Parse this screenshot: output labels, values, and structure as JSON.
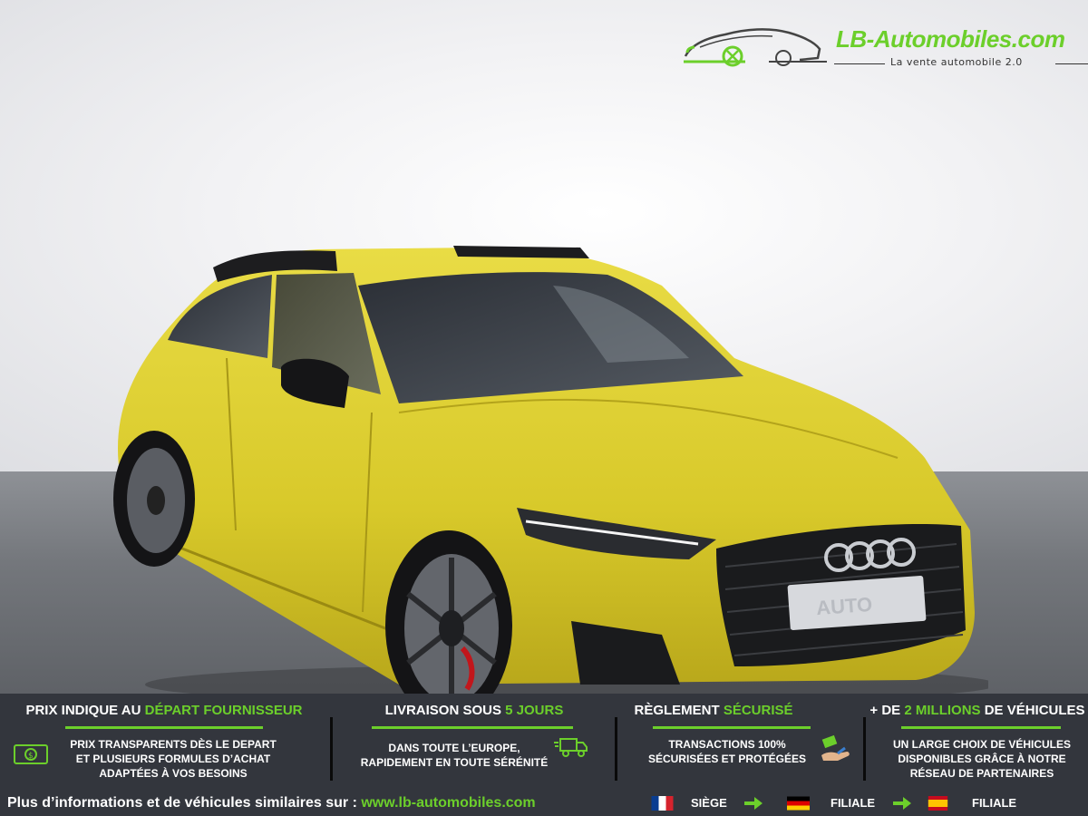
{
  "brand": {
    "name": "LB-Automobiles.com",
    "tagline": "La vente automobile 2.0",
    "color": "#6ccf2b"
  },
  "vehicle": {
    "body_color": "#d8c92a",
    "plate_text": "AUTO"
  },
  "features": [
    {
      "title_prefix": "PRIX INDIQUE AU ",
      "title_highlight": "DÉPART FOURNISSEUR",
      "title_suffix": "",
      "lines": [
        "PRIX TRANSPARENTS DÈS LE DEPART",
        "ET PLUSIEURS FORMULES D’ACHAT",
        "ADAPTÉES À VOS BESOINS"
      ],
      "icon": "money-icon"
    },
    {
      "title_prefix": "LIVRAISON SOUS ",
      "title_highlight": "5 JOURS",
      "title_suffix": "",
      "lines": [
        "DANS TOUTE L’EUROPE,",
        "RAPIDEMENT EN TOUTE SÉRÉNITÉ"
      ],
      "icon": "delivery-truck-icon"
    },
    {
      "title_prefix": "RÈGLEMENT ",
      "title_highlight": "SÉCURISÉ",
      "title_suffix": "",
      "lines": [
        "TRANSACTIONS 100%",
        "SÉCURISÉES ET PROTÉGÉES"
      ],
      "icon": "payment-hand-icon"
    },
    {
      "title_prefix": "+ DE ",
      "title_highlight": "2 MILLIONS",
      "title_suffix": " DE VÉHICULES",
      "lines": [
        "UN LARGE CHOIX DE VÉHICULES",
        "DISPONIBLES GRÂCE À NOTRE",
        "RÉSEAU DE PARTENAIRES"
      ],
      "icon": ""
    }
  ],
  "footer": {
    "text": "Plus d’informations et de véhicules similaires sur : ",
    "url": "www.lb-automobiles.com",
    "locations": [
      {
        "flag": "france-flag-icon",
        "label": "SIÈGE"
      },
      {
        "flag": "germany-flag-icon",
        "label": "FILIALE"
      },
      {
        "flag": "spain-flag-icon",
        "label": "FILIALE"
      }
    ]
  }
}
